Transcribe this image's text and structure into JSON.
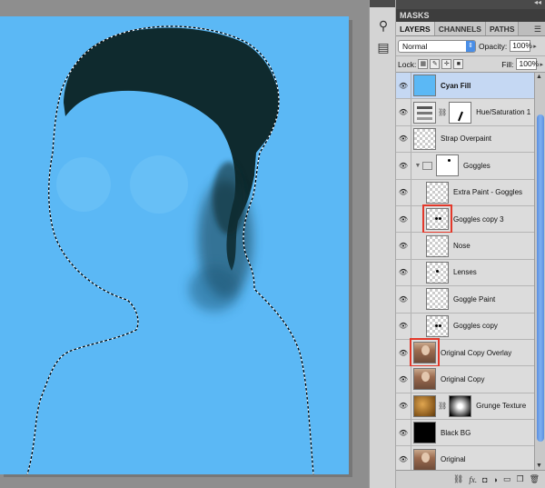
{
  "panel": {
    "masks_label": "MASKS",
    "tabs": [
      {
        "label": "LAYERS",
        "active": true
      },
      {
        "label": "CHANNELS",
        "active": false
      },
      {
        "label": "PATHS",
        "active": false
      }
    ],
    "blend_mode": "Normal",
    "opacity_label": "Opacity:",
    "opacity_value": "100%",
    "lock_label": "Lock:",
    "fill_label": "Fill:",
    "fill_value": "100%"
  },
  "layers": [
    {
      "name": "Cyan Fill",
      "thumb": "solid-blue",
      "selected": true
    },
    {
      "name": "Hue/Saturation 1",
      "thumb": "adj",
      "mask": "white"
    },
    {
      "name": "Strap Overpaint",
      "thumb": "checker"
    },
    {
      "name": "Goggles",
      "thumb": "white",
      "group": true
    },
    {
      "name": "Extra Paint - Goggles",
      "thumb": "checker",
      "indented": true
    },
    {
      "name": "Goggles copy 3",
      "thumb": "checker",
      "indented": true,
      "highlighted": true
    },
    {
      "name": "Nose",
      "thumb": "checker",
      "indented": true
    },
    {
      "name": "Lenses",
      "thumb": "checker",
      "indented": true
    },
    {
      "name": "Goggle Paint",
      "thumb": "checker",
      "indented": true
    },
    {
      "name": "Goggles copy",
      "thumb": "checker",
      "indented": true
    },
    {
      "name": "Original Copy Overlay",
      "thumb": "portrait",
      "highlighted": true
    },
    {
      "name": "Original Copy",
      "thumb": "portrait"
    },
    {
      "name": "Grunge Texture",
      "thumb": "grunge",
      "mask": "mask-radial"
    },
    {
      "name": "Black BG",
      "thumb": "black"
    },
    {
      "name": "Original",
      "thumb": "portrait"
    }
  ],
  "footer_icons": [
    "link-icon",
    "fx-icon",
    "mask-icon",
    "adjustment-icon",
    "folder-icon",
    "new-layer-icon",
    "trash-icon"
  ],
  "colors": {
    "canvas_fill": "#5bb8f5",
    "hair": "#0f2a2e",
    "highlight_box": "#e3382a",
    "selected_layer": "#c5d8f3"
  }
}
